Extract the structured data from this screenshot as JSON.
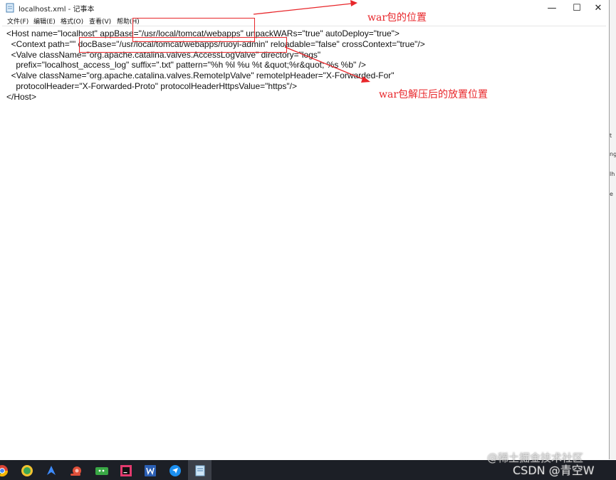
{
  "window": {
    "title": "localhost.xml - 记事本",
    "minimize_glyph": "—",
    "maximize_glyph": "☐",
    "close_glyph": "✕"
  },
  "menu": [
    "文件(F)",
    "编辑(E)",
    "格式(O)",
    "查看(V)",
    "帮助(H)"
  ],
  "editor_text": "<Host name=\"localhost\" appBase=\"/usr/local/tomcat/webapps\" unpackWARs=\"true\" autoDeploy=\"true\">\n  <Context path=\"\" docBase=\"/usr/local/tomcat/webapps/ruoyi-admin\" reloadable=\"false\" crossContext=\"true\"/>\n  <Valve className=\"org.apache.catalina.valves.AccessLogValve\" directory=\"logs\"\n    prefix=\"localhost_access_log\" suffix=\".txt\" pattern=\"%h %l %u %t &quot;%r&quot; %s %b\" />\n  <Valve className=\"org.apache.catalina.valves.RemoteIpValve\" remoteIpHeader=\"X-Forwarded-For\"\n    protocolHeader=\"X-Forwarded-Proto\" protocolHeaderHttpsValue=\"https\"/>\n</Host>",
  "annotations": {
    "war_location": "war包的位置",
    "extract_location": "war包解压后的放置位置"
  },
  "right_strip_marks": [
    "t",
    "ng",
    "lh",
    "e"
  ],
  "watermark": {
    "line1": "@稀土掘金技术社区",
    "line2": "CSDN @青空W"
  },
  "taskbar_icons": [
    "chrome-icon",
    "browser-icon",
    "feishu-icon",
    "snail-icon",
    "wechat-icon",
    "intellij-icon",
    "word-icon",
    "dingtalk-icon",
    "notepad-icon"
  ],
  "colors": {
    "annotation": "#e8262a",
    "taskbar": "#1c1f26"
  }
}
